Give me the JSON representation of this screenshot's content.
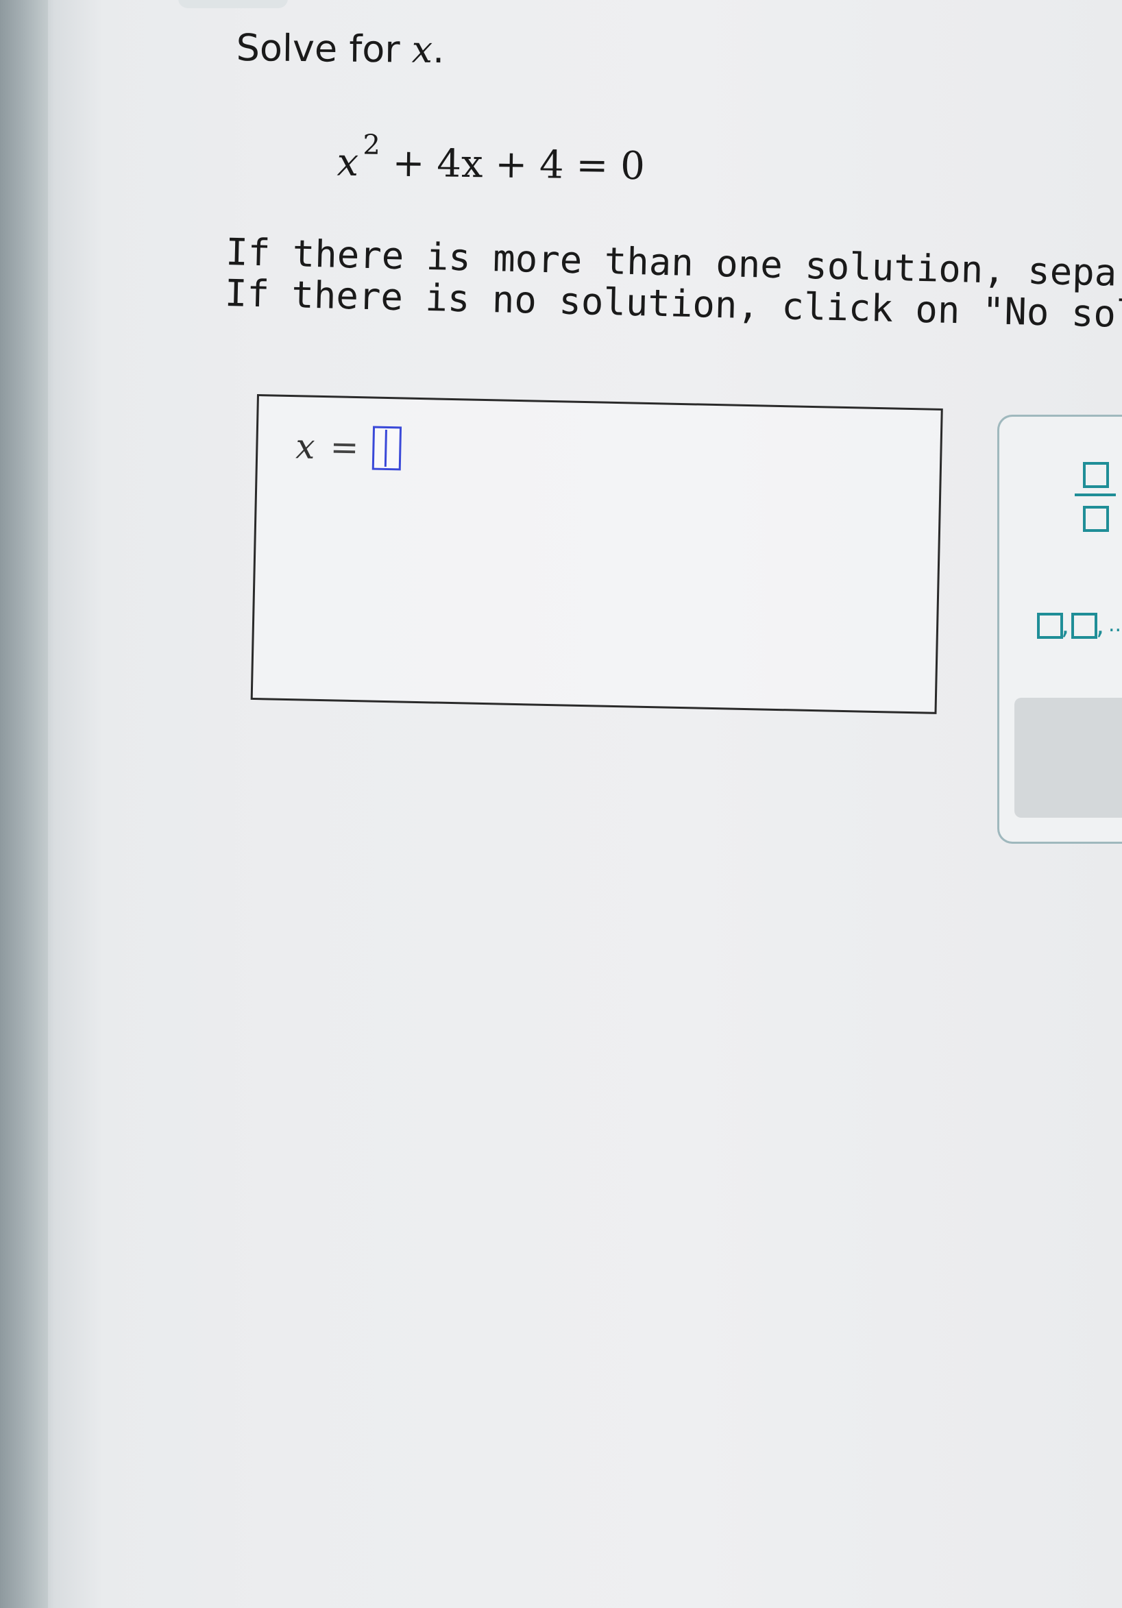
{
  "question": {
    "prompt": "Solve for",
    "variable": "x",
    "period": "."
  },
  "equation": {
    "base": "x",
    "exponent": "2",
    "rest": "+ 4x + 4 = 0"
  },
  "instructions": {
    "line1": "If there is more than one solution, separate the",
    "line2": "If there is no solution, click on \"No solution.\""
  },
  "answer": {
    "variable": "x",
    "equals": "=",
    "value": ""
  },
  "toolbar": {
    "fraction_icon": "fraction-icon",
    "list_icon": "list-separator-icon",
    "list_comma": ",",
    "list_ellipsis": "..",
    "no_solution_icon": "chevron-right-icon",
    "no_solution_glyph": "›"
  },
  "colors": {
    "input_border": "#3a49d8",
    "tool_accent": "#1f8e97"
  }
}
